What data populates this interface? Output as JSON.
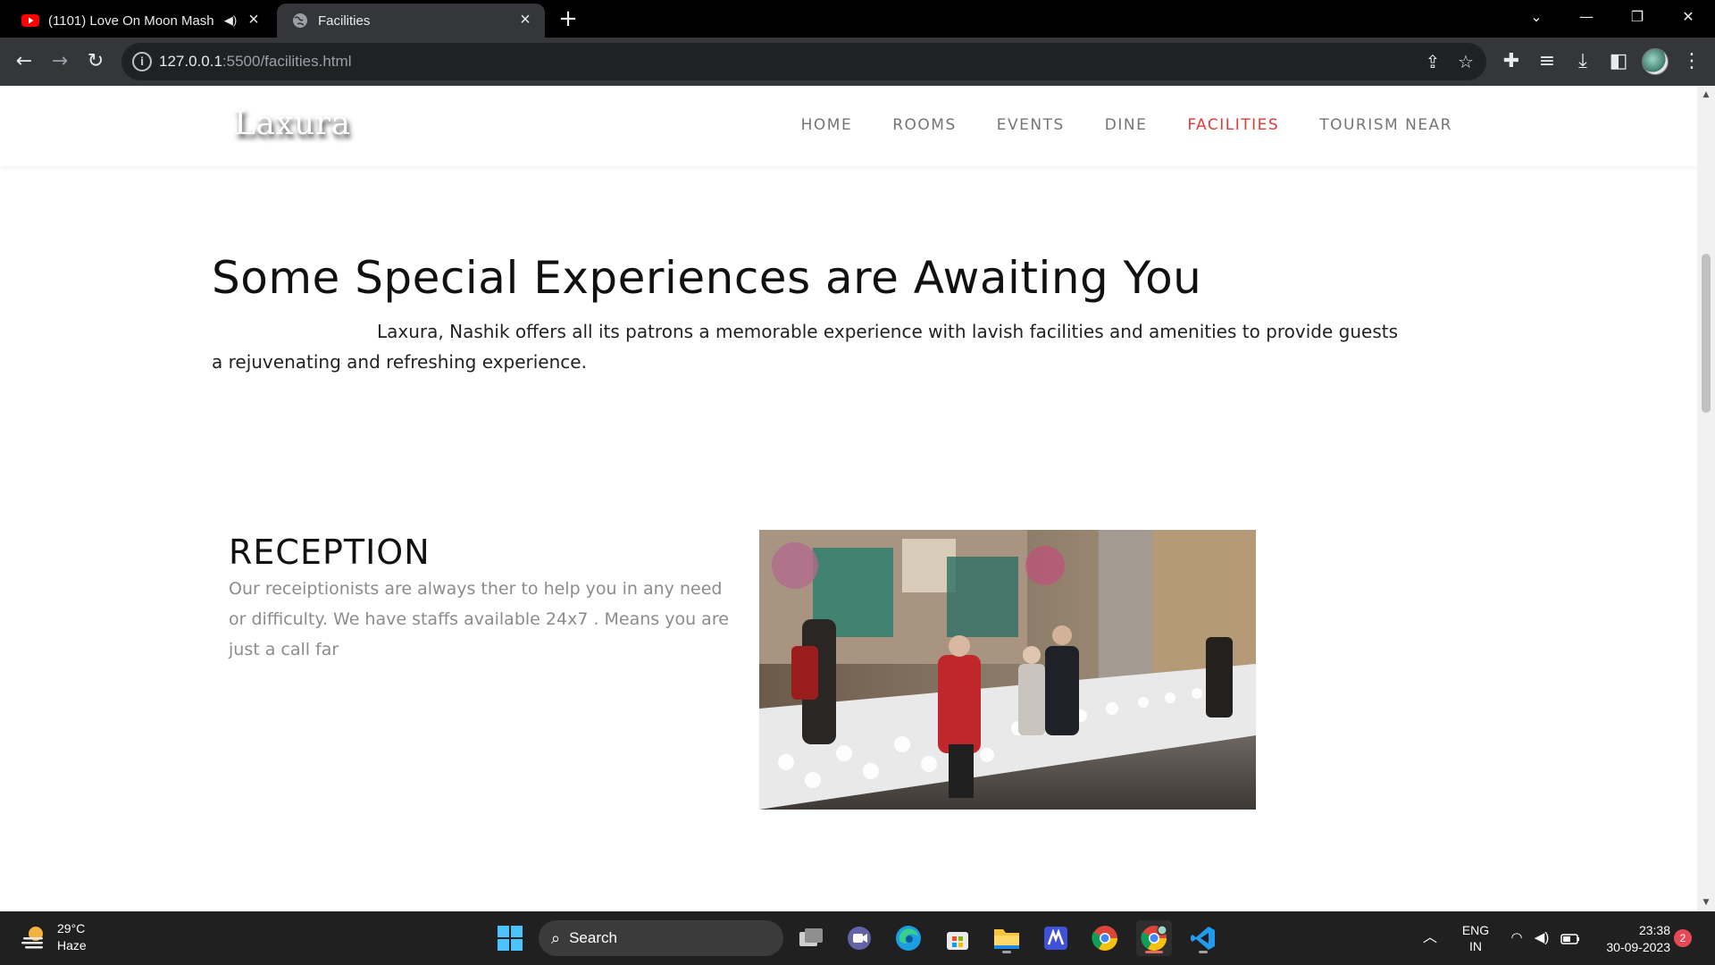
{
  "browser": {
    "tabs": [
      {
        "title": "(1101) Love On Moon Mash",
        "active": false,
        "favicon": "youtube-icon",
        "audio_icon": "speaker-icon"
      },
      {
        "title": "Facilities",
        "active": true,
        "favicon": "globe-icon"
      }
    ],
    "url": {
      "host": "127.0.0.1",
      "path": ":5500/facilities.html"
    }
  },
  "site": {
    "logo": "Laxura",
    "nav": [
      {
        "label": "HOME",
        "active": false
      },
      {
        "label": "ROOMS",
        "active": false
      },
      {
        "label": "EVENTS",
        "active": false
      },
      {
        "label": "DINE",
        "active": false
      },
      {
        "label": "FACILITIES",
        "active": true
      },
      {
        "label": "TOURISM NEAR",
        "active": false
      }
    ],
    "accent_color": "#e53935"
  },
  "main": {
    "heading": "Some Special Experiences are Awaiting You",
    "intro": "Laxura, Nashik offers all its patrons a memorable experience with lavish facilities and amenities to provide guests a rejuvenating and refreshing experience.",
    "sections": [
      {
        "title": "RECEPTION",
        "text": "Our receiptionists are always ther to help you in any need or difficulty. We have staffs available 24x7 . Means you are just a call far",
        "image": "hotel-reception-photo"
      }
    ]
  },
  "taskbar": {
    "weather": {
      "temp": "29°C",
      "condition": "Haze"
    },
    "search_label": "Search",
    "language": {
      "line1": "ENG",
      "line2": "IN"
    },
    "time": "23:38",
    "date": "30-09-2023",
    "notification_count": "2"
  }
}
